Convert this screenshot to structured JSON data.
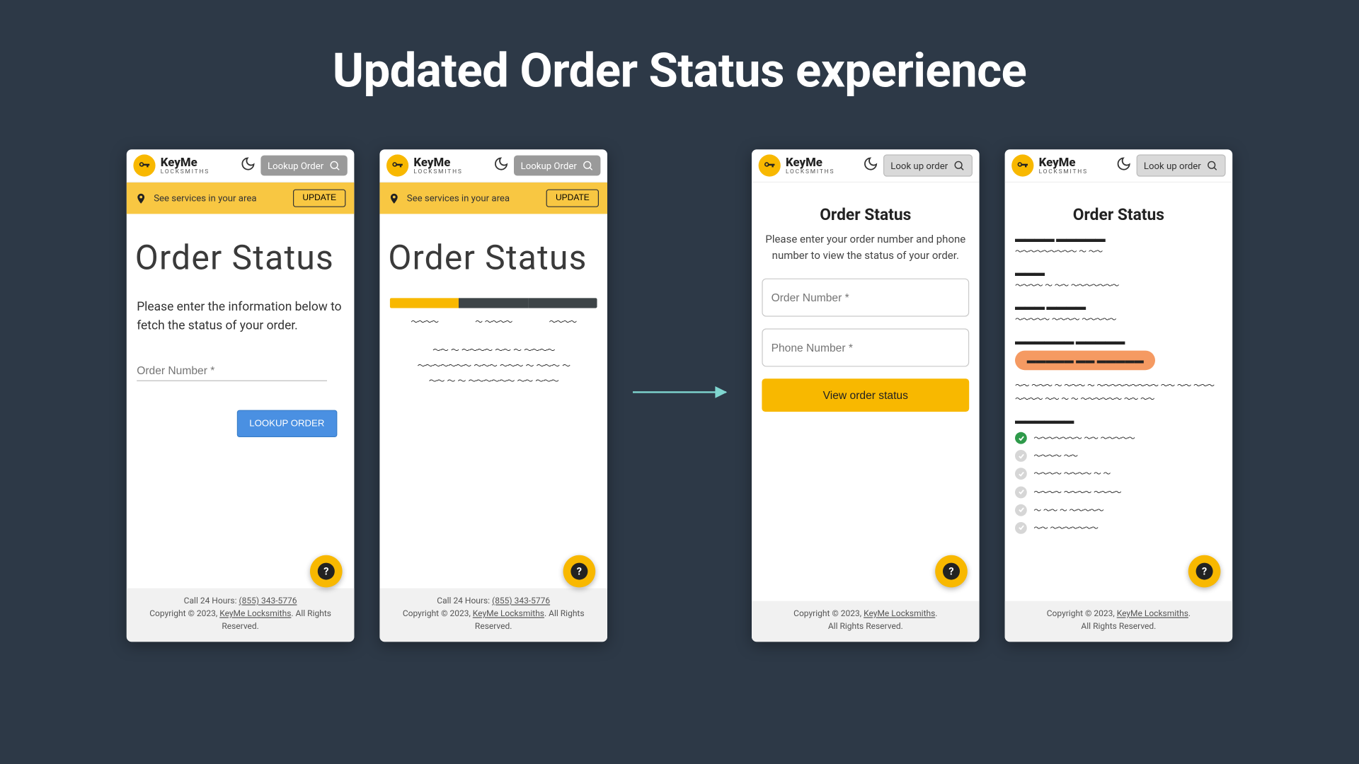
{
  "title": "Updated Order Status experience",
  "brand": {
    "name": "KeyMe",
    "sub": "LOCKSMITHS"
  },
  "header": {
    "lookup_old": "Lookup Order",
    "lookup_new": "Look up order"
  },
  "banner": {
    "text": "See services in your area",
    "button": "UPDATE"
  },
  "old": {
    "heading": "Order Status",
    "prompt": "Please enter the information below to fetch the status of your order.",
    "order_label": "Order Number *",
    "lookup_btn": "LOOKUP ORDER"
  },
  "new": {
    "heading": "Order Status",
    "prompt": "Please enter your order number and phone number to view the status of your order.",
    "order_label": "Order Number *",
    "phone_label": "Phone Number *",
    "view_btn": "View order status"
  },
  "footer": {
    "call_prefix": "Call 24 Hours: ",
    "phone": "(855) 343-5776",
    "copy_prefix": "Copyright © 2023, ",
    "company": "KeyMe Locksmiths",
    "copy_suffix": ". All Rights Reserved."
  }
}
